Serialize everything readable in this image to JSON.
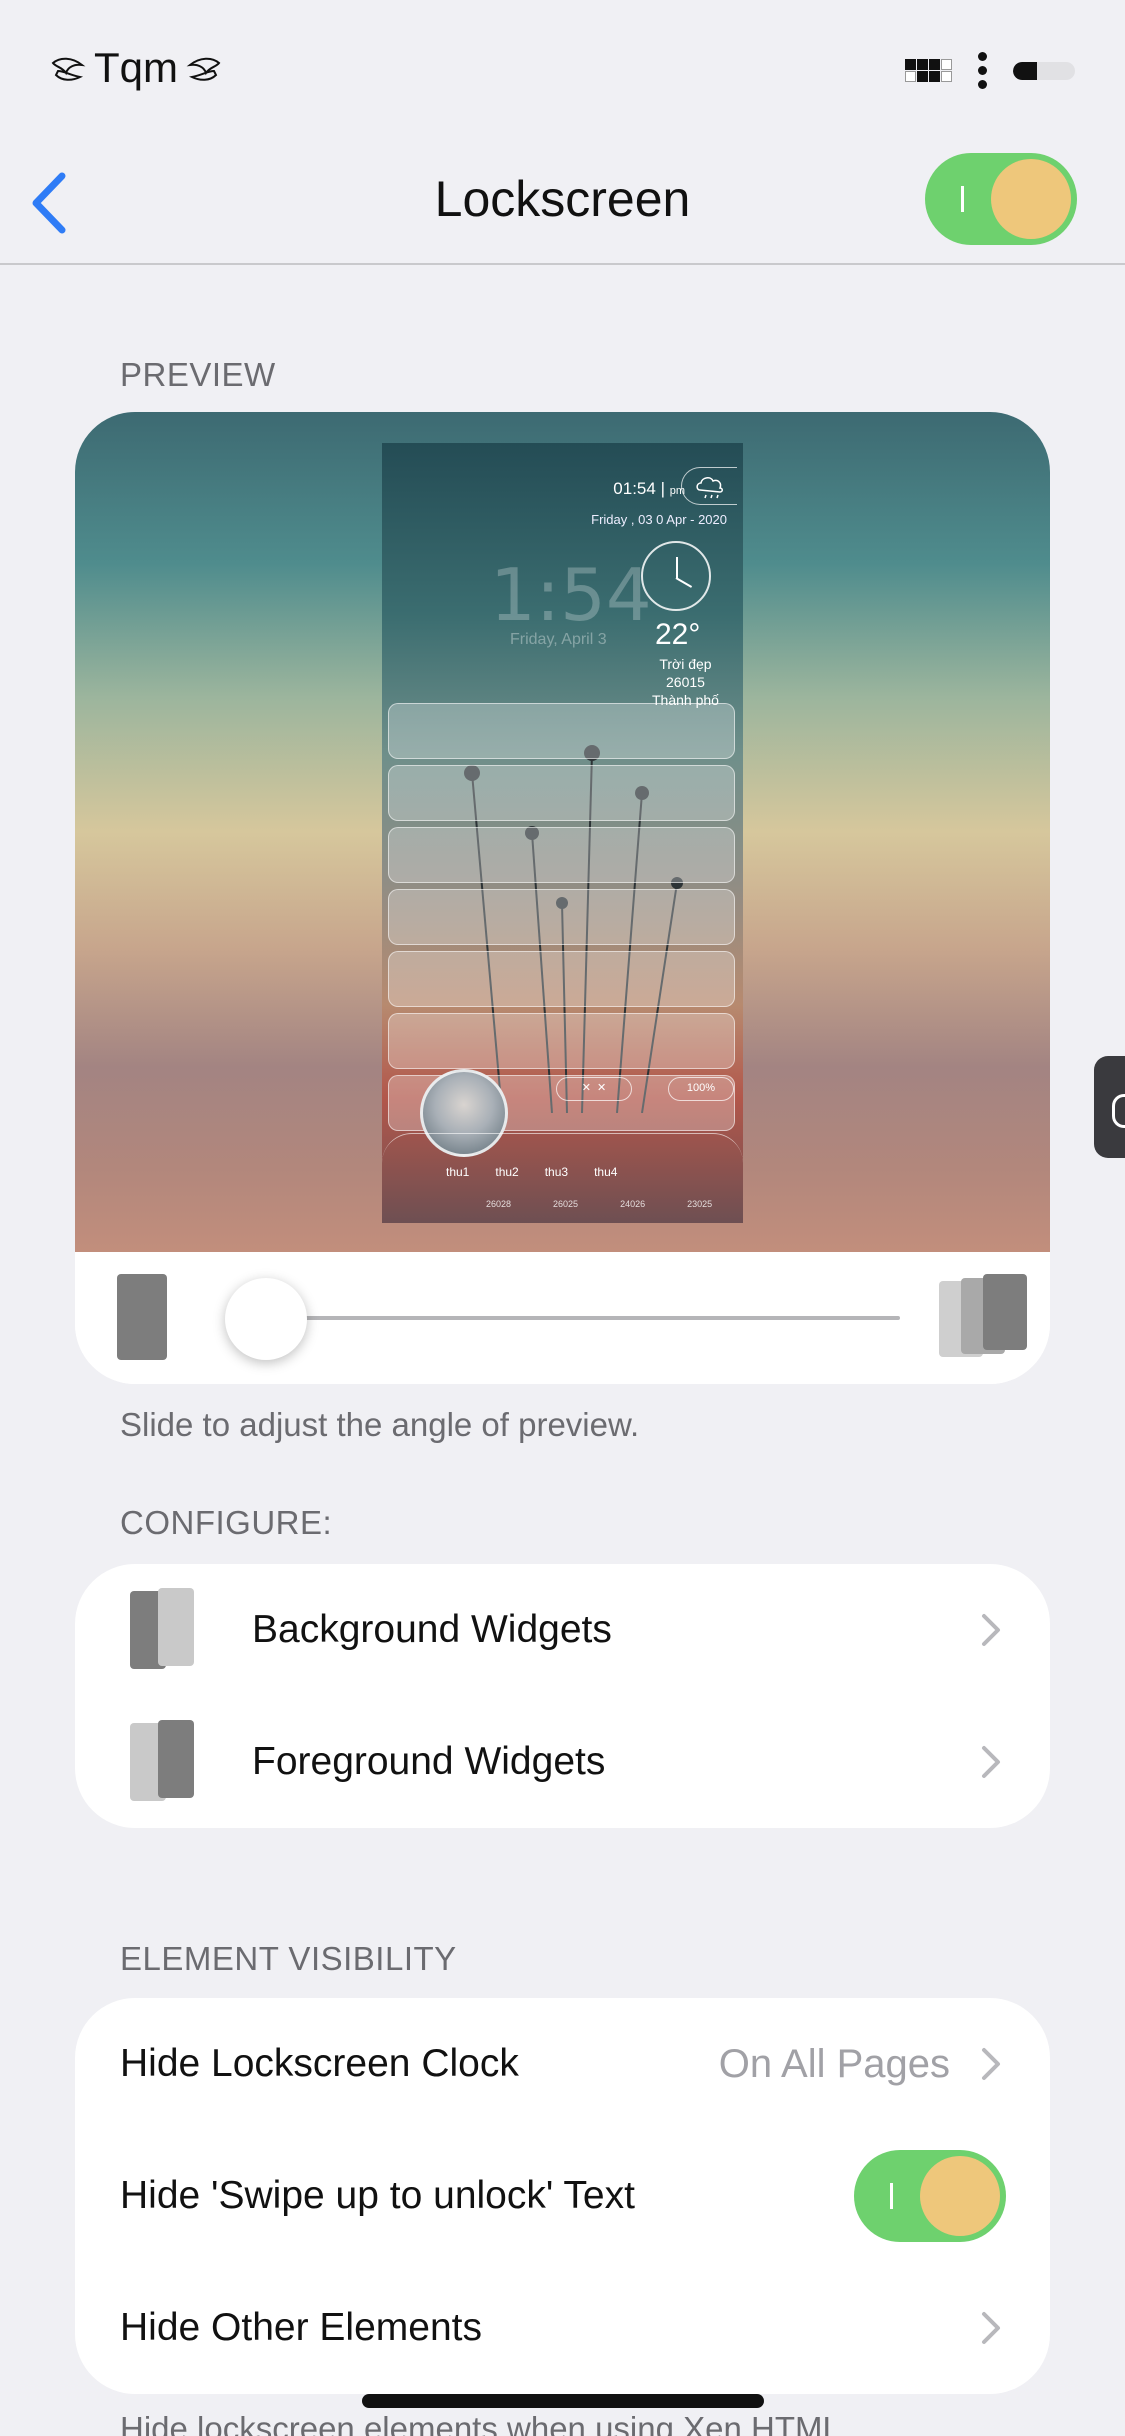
{
  "status_bar": {
    "carrier": "Tqm",
    "signal_icon": "signal-icon",
    "battery_icon": "battery-icon"
  },
  "nav": {
    "title": "Lockscreen",
    "back_icon": "chevron-left-icon",
    "enabled": true
  },
  "preview": {
    "section_label": "PREVIEW",
    "phone": {
      "time": "01:54",
      "ampm": "pm",
      "date": "Friday , 03 0 Apr - 2020",
      "big_time": "1:54",
      "big_date": "Friday, April 3",
      "temperature": "22°",
      "condition": "Trời đẹp",
      "code": "26015",
      "city": "Thành phố",
      "battery": "100%",
      "forecast_days": [
        "thu1",
        "thu2",
        "thu3",
        "thu4"
      ],
      "forecast_codes": [
        "26028",
        "26025",
        "24026",
        "23025"
      ]
    },
    "slider_value": 0,
    "hint": "Slide to adjust the angle of preview."
  },
  "configure": {
    "section_label": "CONFIGURE:",
    "items": [
      {
        "label": "Background Widgets",
        "icon": "background-widgets-icon"
      },
      {
        "label": "Foreground Widgets",
        "icon": "foreground-widgets-icon"
      }
    ]
  },
  "visibility": {
    "section_label": "ELEMENT VISIBILITY",
    "hide_clock": {
      "label": "Hide Lockscreen Clock",
      "value": "On All Pages"
    },
    "hide_swipe": {
      "label": "Hide 'Swipe up to unlock' Text",
      "enabled": true
    },
    "hide_other": {
      "label": "Hide Other Elements"
    },
    "footer": "Hide lockscreen elements when using Xen HTML"
  },
  "colors": {
    "accent_blue": "#2f7cf6",
    "toggle_on": "#6ed16e",
    "toggle_knob": "#eec77b",
    "background": "#f0f0f4"
  }
}
